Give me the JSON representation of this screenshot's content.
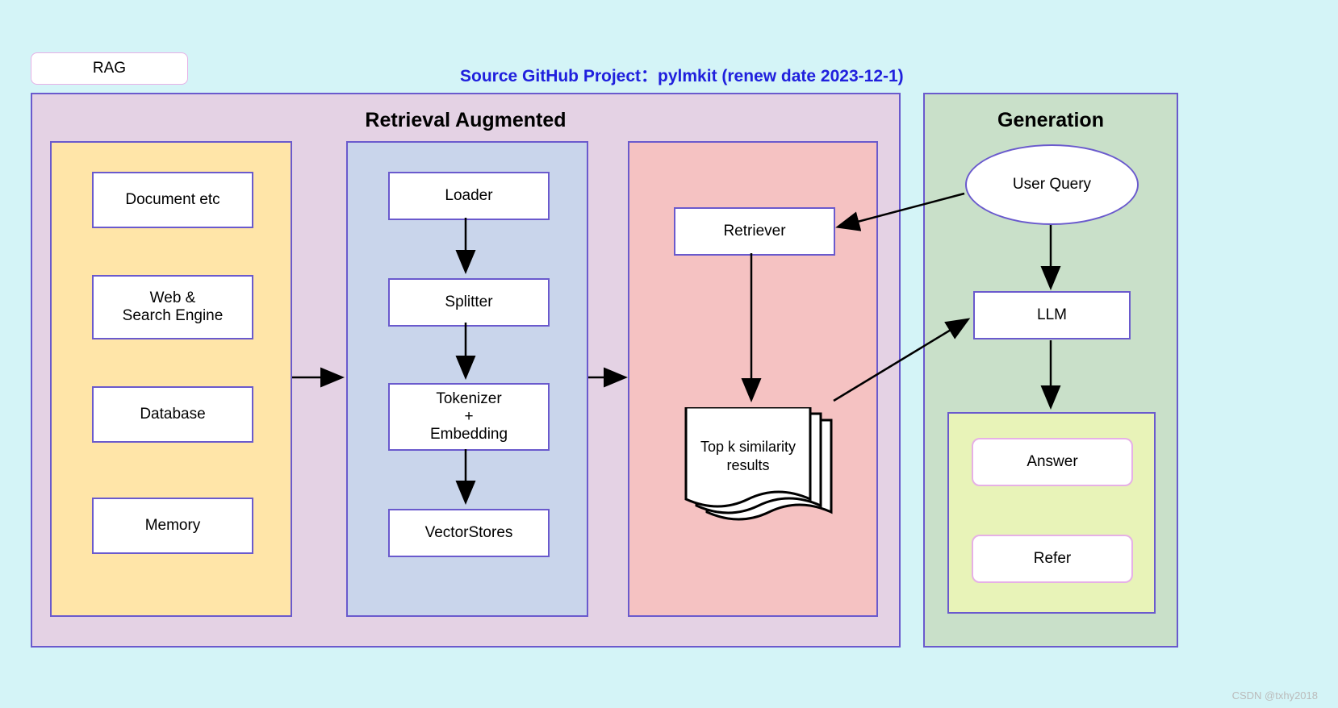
{
  "header": {
    "title": "Source GitHub Project：pylmkit   (renew date 2023-12-1)",
    "rag_label": "RAG"
  },
  "retrieval": {
    "title": "Retrieval Augmented",
    "sources": {
      "items": [
        "Document etc",
        "Web &\nSearch Engine",
        "Database",
        "Memory"
      ]
    },
    "pipeline": {
      "items": [
        "Loader",
        "Splitter",
        "Tokenizer\n+\nEmbedding",
        "VectorStores"
      ]
    },
    "retriever": {
      "label": "Retriever",
      "results_label": "Top k similarity\nresults"
    }
  },
  "generation": {
    "title": "Generation",
    "user_query": "User Query",
    "llm": "LLM",
    "outputs": {
      "answer": "Answer",
      "refer": "Refer"
    }
  },
  "watermark": "CSDN @txhy2018"
}
